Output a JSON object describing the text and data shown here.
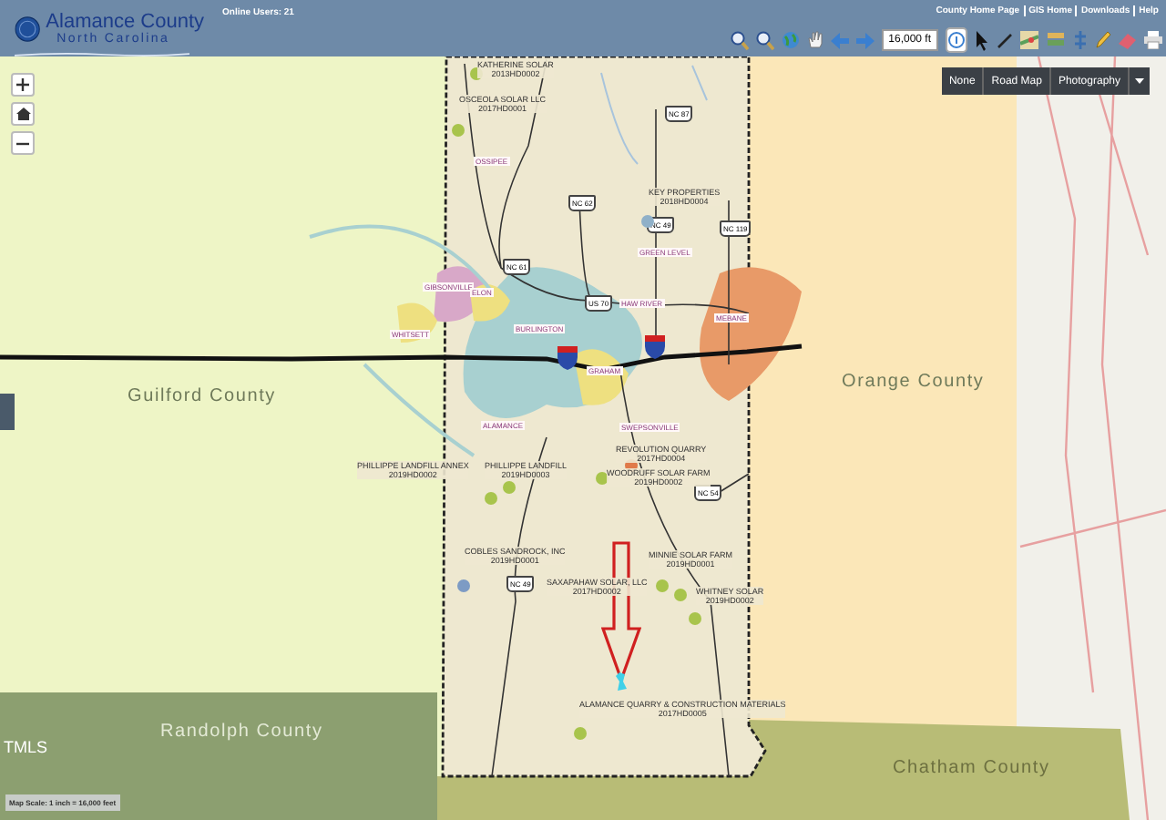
{
  "header": {
    "title": "Alamance County",
    "subtitle": "North Carolina",
    "online_users": "Online Users: 21",
    "links": [
      "County Home Page",
      "GIS Home",
      "Downloads",
      "Help"
    ]
  },
  "toolbar": {
    "scale_field": "16,000 ft"
  },
  "basemap_buttons": [
    "None",
    "Road Map",
    "Photography"
  ],
  "map": {
    "counties": [
      "Guilford County",
      "Orange County",
      "Randolph County",
      "Chatham County"
    ],
    "towns": [
      "OSSIPEE",
      "GIBSONVILLE",
      "ELON",
      "WHITSETT",
      "BURLINGTON",
      "HAW RIVER",
      "GREEN LEVEL",
      "MEBANE",
      "GRAHAM",
      "ALAMANCE",
      "SWEPSONVILLE"
    ],
    "shields": [
      "NC 87",
      "NC 62",
      "NC 49",
      "NC 119",
      "NC 61",
      "US 70",
      "NC 54",
      "NC 49"
    ],
    "sites": [
      {
        "name": "KATHERINE SOLAR",
        "permit": "2013HD0002",
        "color": "#a8c44c"
      },
      {
        "name": "OSCEOLA SOLAR LLC",
        "permit": "2017HD0001",
        "color": "#a8c44c"
      },
      {
        "name": "KEY PROPERTIES",
        "permit": "2018HD0004",
        "color": "#8fb0c8"
      },
      {
        "name": "PHILLIPPE LANDFILL ANNEX",
        "permit": "2019HD0002",
        "color": "#a8c44c"
      },
      {
        "name": "PHILLIPPE LANDFILL",
        "permit": "2019HD0003",
        "color": "#a8c44c"
      },
      {
        "name": "REVOLUTION QUARRY",
        "permit": "2017HD0004",
        "color": "#e07a4a"
      },
      {
        "name": "WOODRUFF SOLAR FARM",
        "permit": "2019HD0002",
        "color": "#a8c44c"
      },
      {
        "name": "COBLES SANDROCK, INC",
        "permit": "2019HD0001",
        "color": "#7d9bc4"
      },
      {
        "name": "MINNIE SOLAR FARM",
        "permit": "2019HD0001",
        "color": "#a8c44c"
      },
      {
        "name": "SAXAPAHAW SOLAR, LLC",
        "permit": "2017HD0002",
        "color": "#a8c44c"
      },
      {
        "name": "WHITNEY SOLAR",
        "permit": "2019HD0002",
        "color": "#a8c44c"
      },
      {
        "name": "ALAMANCE QUARRY & CONSTRUCTION MATERIALS",
        "permit": "2017HD0005",
        "color": "#a8c44c"
      }
    ],
    "watermark": "TMLS",
    "scale_text": "Map Scale: 1 inch = 16,000 feet"
  }
}
